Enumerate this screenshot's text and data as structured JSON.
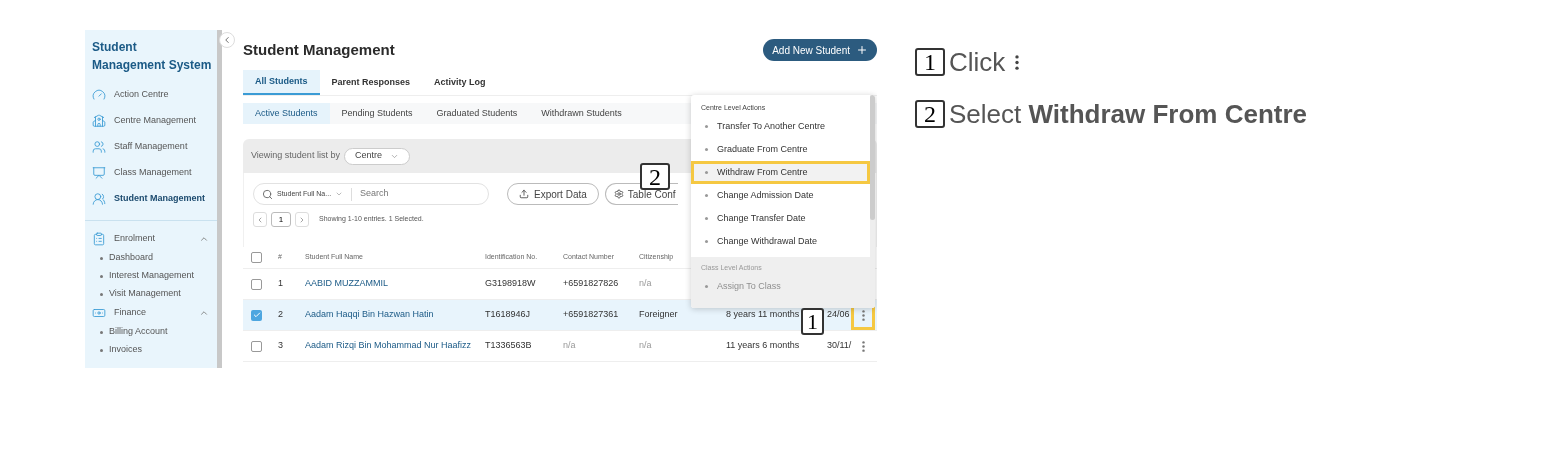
{
  "sidebar": {
    "title": "Student Management System",
    "nav": [
      {
        "label": "Action Centre",
        "selected": false
      },
      {
        "label": "Centre Management",
        "selected": false
      },
      {
        "label": "Staff Management",
        "selected": false
      },
      {
        "label": "Class Management",
        "selected": false
      },
      {
        "label": "Student Management",
        "selected": true
      }
    ],
    "sections": [
      {
        "label": "Enrolment",
        "expanded": true,
        "items": [
          "Dashboard",
          "Interest Management",
          "Visit Management"
        ]
      },
      {
        "label": "Finance",
        "expanded": true,
        "items": [
          "Billing Account",
          "Invoices"
        ]
      }
    ]
  },
  "page": {
    "title": "Student Management",
    "add_button": "Add New Student"
  },
  "tabs": [
    {
      "label": "All Students",
      "selected": true
    },
    {
      "label": "Parent Responses",
      "selected": false
    },
    {
      "label": "Activity Log",
      "selected": false
    }
  ],
  "subtabs": [
    {
      "label": "Active Students",
      "selected": true
    },
    {
      "label": "Pending Students",
      "selected": false
    },
    {
      "label": "Graduated Students",
      "selected": false
    },
    {
      "label": "Withdrawn Students",
      "selected": false
    }
  ],
  "filter": {
    "label": "Viewing student list by",
    "value": "Centre"
  },
  "search": {
    "field": "Student Full Na...",
    "placeholder": "Search"
  },
  "export_button": "Export Data",
  "config_button": "Table Conf",
  "pagination": {
    "page": "1",
    "summary": "Showing 1-10 entries. 1 Selected."
  },
  "table": {
    "all_selected": false,
    "columns": [
      "#",
      "Student Full Name",
      "Identification No.",
      "Contact Number",
      "Citizenship"
    ],
    "rows": [
      {
        "checked": false,
        "cells": [
          {
            "text": "1",
            "muted": false
          },
          {
            "text": "AABID MUZZAMMIL",
            "muted": false
          },
          {
            "text": "G3198918W",
            "muted": false
          },
          {
            "text": "+6591827826",
            "muted": false
          },
          {
            "text": "n/a",
            "muted": true
          }
        ]
      },
      {
        "checked": true,
        "cells": [
          {
            "text": "2",
            "muted": false
          },
          {
            "text": "Aadam Haqqi Bin Hazwan Hatin",
            "muted": false
          },
          {
            "text": "T1618946J",
            "muted": false
          },
          {
            "text": "+6591827361",
            "muted": false
          },
          {
            "text": "Foreigner",
            "muted": false
          }
        ],
        "column_6": "8 years 11 months",
        "column_7": "24/06"
      },
      {
        "checked": false,
        "cells": [
          {
            "text": "3",
            "muted": false
          },
          {
            "text": "Aadam Rizqi Bin Mohammad Nur Haafizz",
            "muted": false
          },
          {
            "text": "T1336563B",
            "muted": false
          },
          {
            "text": "n/a",
            "muted": true
          },
          {
            "text": "n/a",
            "muted": true
          }
        ],
        "column_6": "11 years 6 months",
        "column_7": "30/11/"
      }
    ]
  },
  "menu": {
    "groups": [
      {
        "heading": "Centre Level Actions",
        "disabled": false,
        "items": [
          {
            "label": "Transfer To Another Centre",
            "selected": false
          },
          {
            "label": "Graduate From Centre",
            "selected": false
          },
          {
            "label": "Withdraw From Centre",
            "selected": true
          },
          {
            "label": "Change Admission Date",
            "selected": false
          },
          {
            "label": "Change Transfer Date",
            "selected": false
          },
          {
            "label": "Change Withdrawal Date",
            "selected": false
          }
        ]
      },
      {
        "heading": "Class Level Actions",
        "disabled": true,
        "items": [
          {
            "label": "Assign To Class",
            "selected": false
          }
        ]
      }
    ]
  },
  "callouts": [
    {
      "number": "2"
    },
    {
      "number": "1"
    }
  ],
  "steps": [
    {
      "number": "1",
      "text": "Click",
      "kind": "icon"
    },
    {
      "number": "2",
      "text": "Select **Withdraw From Centre**",
      "kind": "text"
    }
  ]
}
